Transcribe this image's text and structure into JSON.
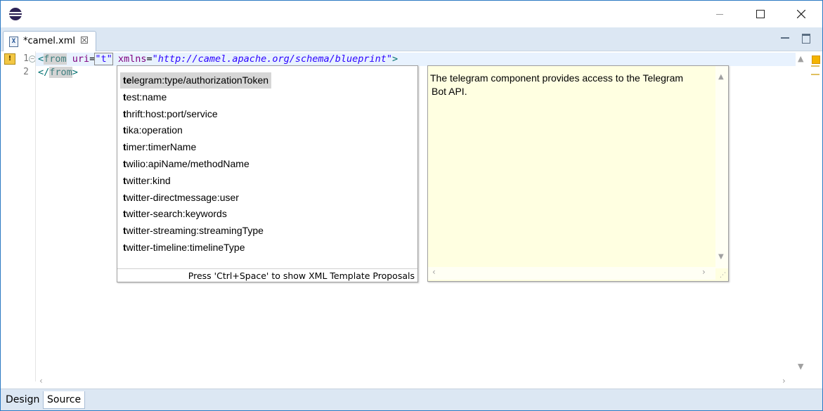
{
  "window": {
    "minimize_icon": "minimize-icon",
    "maximize_icon": "maximize-icon",
    "close_icon": "close-icon"
  },
  "editor_tab": {
    "label": "*camel.xml",
    "close_glyph": "⛝"
  },
  "editor": {
    "lines": [
      {
        "number": "1",
        "tokens": [
          "<",
          "from",
          " ",
          "uri",
          "=",
          "\"t\"",
          " ",
          "xmlns",
          "=",
          "\"http://camel.apache.org/schema/blueprint\"",
          ">"
        ]
      },
      {
        "number": "2",
        "tokens": [
          "</",
          "from",
          ">"
        ]
      }
    ]
  },
  "content_assist": {
    "proposals": [
      {
        "bold": "t",
        "rest": "elegram:type/authorizationToken",
        "selected": true,
        "bold_len": 2
      },
      {
        "bold": "t",
        "rest": "est:name"
      },
      {
        "bold": "t",
        "rest": "hrift:host:port/service"
      },
      {
        "bold": "t",
        "rest": "ika:operation"
      },
      {
        "bold": "t",
        "rest": "imer:timerName"
      },
      {
        "bold": "t",
        "rest": "wilio:apiName/methodName"
      },
      {
        "bold": "t",
        "rest": "witter:kind"
      },
      {
        "bold": "t",
        "rest": "witter-directmessage:user"
      },
      {
        "bold": "t",
        "rest": "witter-search:keywords"
      },
      {
        "bold": "t",
        "rest": "witter-streaming:streamingType"
      },
      {
        "bold": "t",
        "rest": "witter-timeline:timelineType"
      }
    ],
    "footer": "Press 'Ctrl+Space' to show XML Template Proposals"
  },
  "doc_popup": {
    "text_line1": "The telegram component provides access to the Telegram",
    "text_line2": "Bot API."
  },
  "bottom_tabs": {
    "design": "Design",
    "source": "Source"
  },
  "colors": {
    "frame": "#2b79c2",
    "tab_bar": "#dce7f3",
    "current_line": "#e8f2fe",
    "doc_bg": "#ffffe1",
    "selection": "#d6d6d6"
  }
}
